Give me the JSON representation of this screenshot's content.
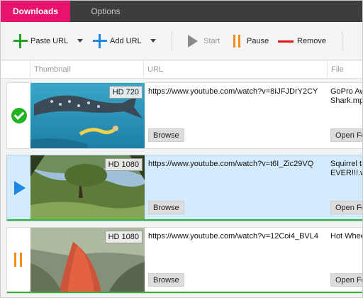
{
  "tabs": [
    {
      "label": "Downloads",
      "active": true
    },
    {
      "label": "Options",
      "active": false
    }
  ],
  "toolbar": {
    "paste_url": "Paste URL",
    "add_url": "Add URL",
    "start": "Start",
    "pause": "Pause",
    "remove": "Remove"
  },
  "columns": {
    "thumbnail": "Thumbnail",
    "url": "URL",
    "file": "File"
  },
  "rows": [
    {
      "status": "complete",
      "quality": "HD 720",
      "url": "https://www.youtube.com/watch?v=8IJFJDrY2CY",
      "file_line1": "GoPro Aw",
      "file_line2": "Shark.mp",
      "browse": "Browse",
      "open_folder": "Open Fo"
    },
    {
      "status": "downloading",
      "quality": "HD 1080",
      "url": "https://www.youtube.com/watch?v=t6I_Zic29VQ",
      "file_line1": "Squirrel ta",
      "file_line2": "EVER!!!.w",
      "browse": "Browse",
      "open_folder": "Open Fo"
    },
    {
      "status": "paused",
      "quality": "HD 1080",
      "url": "https://www.youtube.com/watch?v=12Coi4_BVL4",
      "file_line1": "Hot Whee",
      "file_line2": "",
      "browse": "Browse",
      "open_folder": "Open Fo"
    }
  ],
  "colors": {
    "accent": "#e8136c",
    "tabbar_bg": "#3d3d3d",
    "plus_green": "#21a321",
    "plus_blue": "#1e88e5",
    "pause_orange": "#f28c1a",
    "remove_red": "#e01414",
    "selected_row": "#d3ebfd",
    "progress_green": "#36b536"
  },
  "icons": {
    "paste_url": "plus-icon-green",
    "add_url": "plus-icon-blue",
    "start": "play-icon",
    "pause": "pause-icon",
    "remove": "minus-icon",
    "status_complete": "check-circle-icon",
    "status_downloading": "play-icon",
    "status_paused": "pause-icon"
  }
}
